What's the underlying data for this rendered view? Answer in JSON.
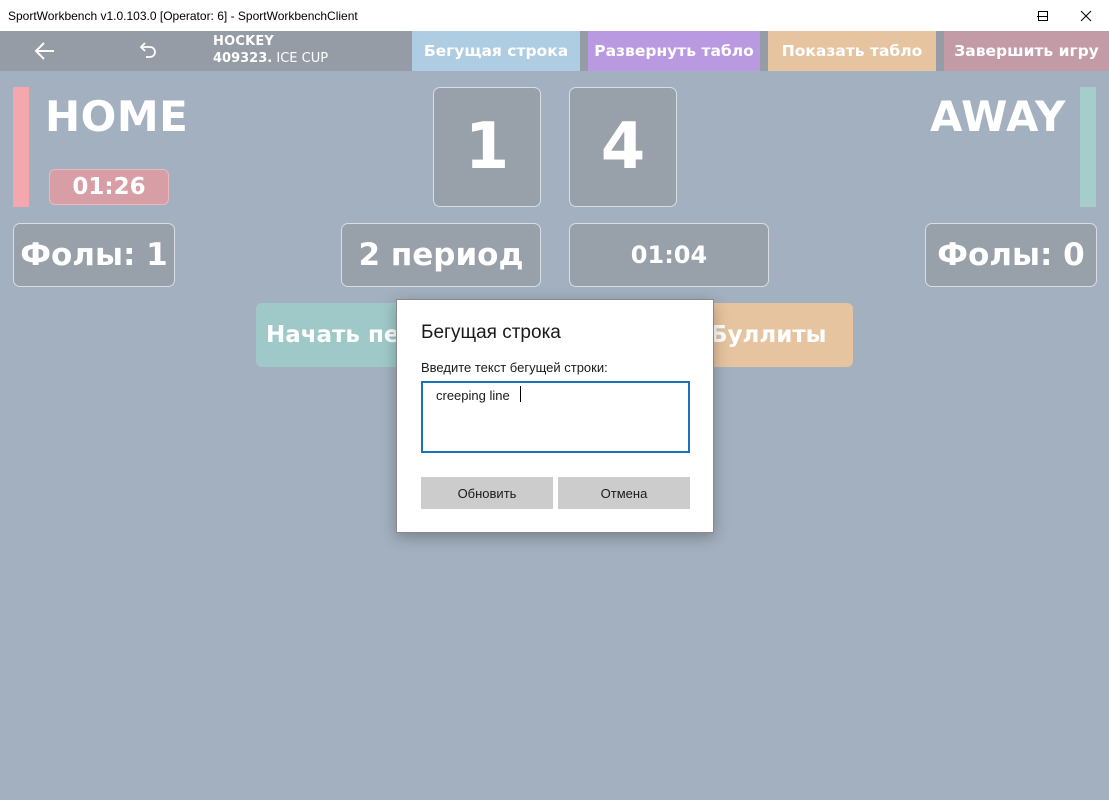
{
  "window": {
    "title": "SportWorkbench v1.0.103.0 [Operator: 6] - SportWorkbenchClient",
    "controls": [
      "minimize-icon",
      "maximize-icon",
      "close-icon"
    ]
  },
  "toolbar": {
    "back_icon": "arrow-left-icon",
    "undo_icon": "undo-icon",
    "sport": "HOCKEY",
    "game_id": "409323.",
    "tournament": "ICE CUP",
    "buttons": [
      {
        "label": "Бегущая строка",
        "color": "#aecde2"
      },
      {
        "label": "Развернуть табло",
        "color": "#b99ae0"
      },
      {
        "label": "Показать табло",
        "color": "#e6c4a0"
      },
      {
        "label": "Завершить игру",
        "color": "#c39ba6"
      }
    ]
  },
  "home": {
    "name": "HOME",
    "color": "#f4a7ad",
    "penalty_timer": "01:26",
    "score": "1",
    "fouls": "Фолы: 1"
  },
  "away": {
    "name": "AWAY",
    "color": "#a6cdc9",
    "score": "4",
    "fouls": "Фолы: 0"
  },
  "period": "2 период",
  "game_clock": "01:04",
  "actions": {
    "start_period_visible": "Начать пе",
    "shootout_visible": "Буллиты",
    "start_color": "#9fc9c9",
    "shootout_color": "#e6c4a0"
  },
  "dialog": {
    "title": "Бегущая строка",
    "label": "Введите текст бегущей строки:",
    "input_value": "creeping line ",
    "update_button": "Обновить",
    "cancel_button": "Отмена"
  }
}
